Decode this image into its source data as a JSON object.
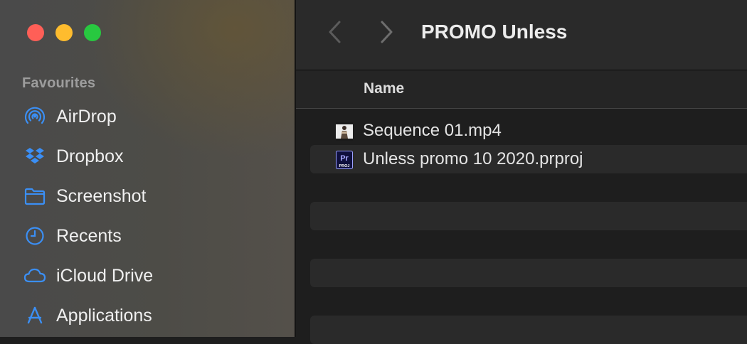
{
  "window": {
    "title": "PROMO Unless",
    "controls": [
      "close",
      "minimize",
      "zoom"
    ]
  },
  "toolbar": {
    "back_icon": "chevron-left-icon",
    "forward_icon": "chevron-right-icon"
  },
  "sidebar": {
    "section_title": "Favourites",
    "items": [
      {
        "label": "AirDrop",
        "icon": "airdrop-icon"
      },
      {
        "label": "Dropbox",
        "icon": "dropbox-icon"
      },
      {
        "label": "Screenshot",
        "icon": "folder-icon"
      },
      {
        "label": "Recents",
        "icon": "clock-icon"
      },
      {
        "label": "iCloud Drive",
        "icon": "cloud-icon"
      },
      {
        "label": "Applications",
        "icon": "applications-icon"
      }
    ]
  },
  "list": {
    "columns": [
      "Name"
    ],
    "files": [
      {
        "name": "Sequence 01.mp4",
        "icon": "video-thumbnail-icon"
      },
      {
        "name": "Unless promo 10 2020.prproj",
        "icon": "premiere-project-icon",
        "badge": "Pr",
        "badge_sub": "PROJ"
      }
    ]
  },
  "colors": {
    "accent": "#3b8ff5",
    "traffic_close": "#ff5f57",
    "traffic_minimize": "#febc2e",
    "traffic_zoom": "#28c840",
    "premiere": "#2a2ab8"
  }
}
